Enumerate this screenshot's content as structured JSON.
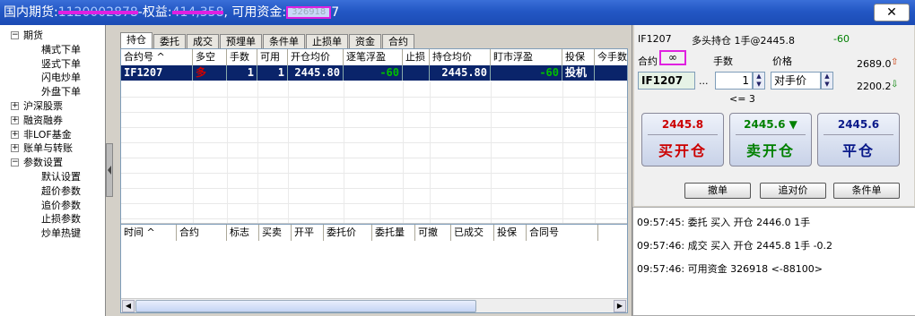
{
  "titlebar": {
    "prefix": "国内期货:",
    "account": "1120002878",
    "equity_label": "-权益:",
    "equity": "414,358",
    "funds_label": ", 可用资金:",
    "funds": "326918",
    "funds_tail": "7",
    "close": "✕"
  },
  "tree": [
    {
      "label": "期货",
      "level": 0,
      "exp": "−"
    },
    {
      "label": "横式下单",
      "level": 1
    },
    {
      "label": "竖式下单",
      "level": 1
    },
    {
      "label": "闪电炒单",
      "level": 1
    },
    {
      "label": "外盘下单",
      "level": 1
    },
    {
      "label": "沪深股票",
      "level": 0,
      "exp": "+"
    },
    {
      "label": "融资融券",
      "level": 0,
      "exp": "+"
    },
    {
      "label": "非LOF基金",
      "level": 0,
      "exp": "+"
    },
    {
      "label": "账单与转账",
      "level": 0,
      "exp": "+"
    },
    {
      "label": "参数设置",
      "level": 0,
      "exp": "−"
    },
    {
      "label": "默认设置",
      "level": 1
    },
    {
      "label": "超价参数",
      "level": 1
    },
    {
      "label": "追价参数",
      "level": 1
    },
    {
      "label": "止损参数",
      "level": 1
    },
    {
      "label": "炒单热键",
      "level": 1
    }
  ],
  "tabs": [
    "持仓",
    "委托",
    "成交",
    "预埋单",
    "条件单",
    "止损单",
    "资金",
    "合约"
  ],
  "positions": {
    "columns": [
      "合约号 ^",
      "多空",
      "手数",
      "可用",
      "开仓均价",
      "逐笔浮盈",
      "止损",
      "持仓均价",
      "盯市浮盈",
      "投保",
      "今手数"
    ],
    "rows": [
      [
        "IF1207",
        "多",
        "1",
        "1",
        "2445.80",
        "-60",
        "",
        "2445.80",
        "-60",
        "投机",
        ""
      ]
    ]
  },
  "orders": {
    "columns": [
      "时间 ^",
      "合约",
      "标志",
      "买卖",
      "开平",
      "委托价",
      "委托量",
      "可撤",
      "已成交",
      "投保",
      "合同号"
    ]
  },
  "order_panel": {
    "instrument_code": "IF1207",
    "position_summary": "多头持仓 1手@2445.8",
    "position_pnl": "-60",
    "contract_label": "合约",
    "link_icon": "∞",
    "qty_label": "手数",
    "price_label": "价格",
    "contract_value": "IF1207",
    "ellipsis": "...",
    "qty_value": "1",
    "price_value": "对手价",
    "qty_hint": "<= 3",
    "upper_price": "2689.0",
    "lower_price": "2200.2",
    "buy_open": {
      "price": "2445.8",
      "label": "买开仓"
    },
    "sell_open": {
      "price": "2445.6 ▼",
      "label": "卖开仓"
    },
    "close": {
      "price": "2445.6",
      "label": "平仓"
    },
    "cancel": "撤单",
    "chase": "追对价",
    "conditional": "条件单"
  },
  "log": [
    "09:57:45: 委托 买入 开仓 2446.0 1手",
    "09:57:46: 成交 买入 开仓 2445.8 1手 -0.2",
    "09:57:46: 可用资金 326918 <-88100>"
  ],
  "colors": {
    "buy": "#cc0000",
    "sell": "#008000",
    "close": "#0a1a8a",
    "selection": "#0a246a",
    "pnl_negative": "#008000"
  }
}
